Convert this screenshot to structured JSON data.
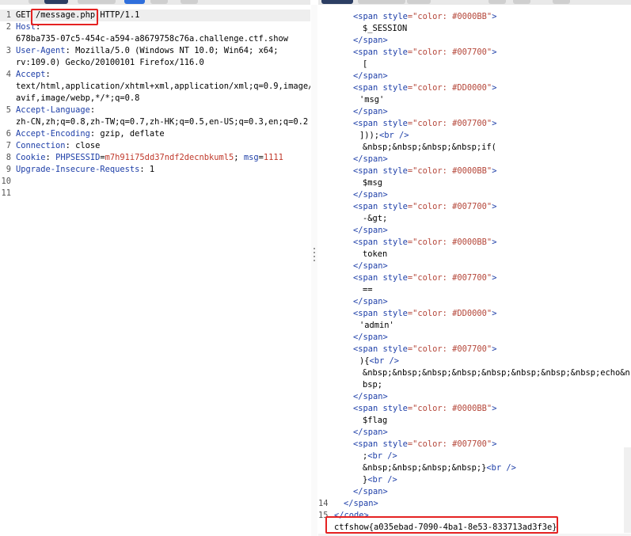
{
  "request": {
    "lines": [
      {
        "num": "1",
        "parts": [
          {
            "t": "GET ",
            "c": "hval"
          },
          {
            "t": "/message.php",
            "c": "hval"
          },
          {
            "t": " HTTP/1.1",
            "c": "hval"
          }
        ]
      },
      {
        "num": "2",
        "parts": [
          {
            "t": "Host",
            "c": "hname"
          },
          {
            "t": ":",
            "c": "hval"
          }
        ]
      },
      {
        "num": "",
        "parts": [
          {
            "t": "678ba735-07c5-454c-a594-a8679758c76a.challenge.ctf.show",
            "c": "hval"
          }
        ]
      },
      {
        "num": "3",
        "parts": [
          {
            "t": "User-Agent",
            "c": "hname"
          },
          {
            "t": ": Mozilla/5.0 (Windows NT 10.0; Win64; x64;",
            "c": "hval"
          }
        ]
      },
      {
        "num": "",
        "parts": [
          {
            "t": "rv:109.0) Gecko/20100101 Firefox/116.0",
            "c": "hval"
          }
        ]
      },
      {
        "num": "4",
        "parts": [
          {
            "t": "Accept",
            "c": "hname"
          },
          {
            "t": ":",
            "c": "hval"
          }
        ]
      },
      {
        "num": "",
        "parts": [
          {
            "t": "text/html,application/xhtml+xml,application/xml;q=0.9,image/",
            "c": "hval"
          }
        ]
      },
      {
        "num": "",
        "parts": [
          {
            "t": "avif,image/webp,*/*;q=0.8",
            "c": "hval"
          }
        ]
      },
      {
        "num": "5",
        "parts": [
          {
            "t": "Accept-Language",
            "c": "hname"
          },
          {
            "t": ":",
            "c": "hval"
          }
        ]
      },
      {
        "num": "",
        "parts": [
          {
            "t": "zh-CN,zh;q=0.8,zh-TW;q=0.7,zh-HK;q=0.5,en-US;q=0.3,en;q=0.2",
            "c": "hval"
          }
        ]
      },
      {
        "num": "6",
        "parts": [
          {
            "t": "Accept-Encoding",
            "c": "hname"
          },
          {
            "t": ": gzip, deflate",
            "c": "hval"
          }
        ]
      },
      {
        "num": "7",
        "parts": [
          {
            "t": "Connection",
            "c": "hname"
          },
          {
            "t": ": close",
            "c": "hval"
          }
        ]
      },
      {
        "num": "8",
        "parts": [
          {
            "t": "Cookie",
            "c": "hname"
          },
          {
            "t": ": ",
            "c": "hval"
          },
          {
            "t": "PHPSESSID",
            "c": "hname"
          },
          {
            "t": "=",
            "c": "hval"
          },
          {
            "t": "m7h91i75dd37ndf2decnbkuml5",
            "c": "cookie-val"
          },
          {
            "t": "; ",
            "c": "hval"
          },
          {
            "t": "msg",
            "c": "hname"
          },
          {
            "t": "=",
            "c": "hval"
          },
          {
            "t": "1111",
            "c": "cookie-val"
          }
        ]
      },
      {
        "num": "9",
        "parts": [
          {
            "t": "Upgrade-Insecure-Requests",
            "c": "hname"
          },
          {
            "t": ": 1",
            "c": "hval"
          }
        ]
      },
      {
        "num": "10",
        "parts": []
      },
      {
        "num": "11",
        "parts": []
      }
    ]
  },
  "response": {
    "lines": [
      {
        "num": "",
        "indent": 44,
        "parts": [
          {
            "t": "<span ",
            "c": "tag"
          },
          {
            "t": "style",
            "c": "attr"
          },
          {
            "t": "=\"color: #0000BB\"",
            "c": "str"
          },
          {
            "t": ">",
            "c": "tag"
          }
        ]
      },
      {
        "num": "",
        "indent": 56,
        "parts": [
          {
            "t": "$_SESSION",
            "c": "txt"
          }
        ]
      },
      {
        "num": "",
        "indent": 44,
        "parts": [
          {
            "t": "</span>",
            "c": "tag"
          }
        ]
      },
      {
        "num": "",
        "indent": 44,
        "parts": [
          {
            "t": "<span ",
            "c": "tag"
          },
          {
            "t": "style",
            "c": "attr"
          },
          {
            "t": "=\"color: #007700\"",
            "c": "str"
          },
          {
            "t": ">",
            "c": "tag"
          }
        ]
      },
      {
        "num": "",
        "indent": 56,
        "parts": [
          {
            "t": "[",
            "c": "txt"
          }
        ]
      },
      {
        "num": "",
        "indent": 44,
        "parts": [
          {
            "t": "</span>",
            "c": "tag"
          }
        ]
      },
      {
        "num": "",
        "indent": 44,
        "parts": [
          {
            "t": "<span ",
            "c": "tag"
          },
          {
            "t": "style",
            "c": "attr"
          },
          {
            "t": "=\"color: #DD0000\"",
            "c": "str"
          },
          {
            "t": ">",
            "c": "tag"
          }
        ]
      },
      {
        "num": "",
        "indent": 52,
        "parts": [
          {
            "t": "'msg'",
            "c": "txt"
          }
        ]
      },
      {
        "num": "",
        "indent": 44,
        "parts": [
          {
            "t": "</span>",
            "c": "tag"
          }
        ]
      },
      {
        "num": "",
        "indent": 44,
        "parts": [
          {
            "t": "<span ",
            "c": "tag"
          },
          {
            "t": "style",
            "c": "attr"
          },
          {
            "t": "=\"color: #007700\"",
            "c": "str"
          },
          {
            "t": ">",
            "c": "tag"
          }
        ]
      },
      {
        "num": "",
        "indent": 52,
        "parts": [
          {
            "t": "]));",
            "c": "txt"
          },
          {
            "t": "<br />",
            "c": "tag"
          }
        ]
      },
      {
        "num": "",
        "indent": 56,
        "parts": [
          {
            "t": "&nbsp;&nbsp;&nbsp;&nbsp;if(",
            "c": "txt"
          }
        ]
      },
      {
        "num": "",
        "indent": 44,
        "parts": [
          {
            "t": "</span>",
            "c": "tag"
          }
        ]
      },
      {
        "num": "",
        "indent": 44,
        "parts": [
          {
            "t": "<span ",
            "c": "tag"
          },
          {
            "t": "style",
            "c": "attr"
          },
          {
            "t": "=\"color: #0000BB\"",
            "c": "str"
          },
          {
            "t": ">",
            "c": "tag"
          }
        ]
      },
      {
        "num": "",
        "indent": 56,
        "parts": [
          {
            "t": "$msg",
            "c": "txt"
          }
        ]
      },
      {
        "num": "",
        "indent": 44,
        "parts": [
          {
            "t": "</span>",
            "c": "tag"
          }
        ]
      },
      {
        "num": "",
        "indent": 44,
        "parts": [
          {
            "t": "<span ",
            "c": "tag"
          },
          {
            "t": "style",
            "c": "attr"
          },
          {
            "t": "=\"color: #007700\"",
            "c": "str"
          },
          {
            "t": ">",
            "c": "tag"
          }
        ]
      },
      {
        "num": "",
        "indent": 56,
        "parts": [
          {
            "t": "-&gt;",
            "c": "txt"
          }
        ]
      },
      {
        "num": "",
        "indent": 44,
        "parts": [
          {
            "t": "</span>",
            "c": "tag"
          }
        ]
      },
      {
        "num": "",
        "indent": 44,
        "parts": [
          {
            "t": "<span ",
            "c": "tag"
          },
          {
            "t": "style",
            "c": "attr"
          },
          {
            "t": "=\"color: #0000BB\"",
            "c": "str"
          },
          {
            "t": ">",
            "c": "tag"
          }
        ]
      },
      {
        "num": "",
        "indent": 56,
        "parts": [
          {
            "t": "token",
            "c": "txt"
          }
        ]
      },
      {
        "num": "",
        "indent": 44,
        "parts": [
          {
            "t": "</span>",
            "c": "tag"
          }
        ]
      },
      {
        "num": "",
        "indent": 44,
        "parts": [
          {
            "t": "<span ",
            "c": "tag"
          },
          {
            "t": "style",
            "c": "attr"
          },
          {
            "t": "=\"color: #007700\"",
            "c": "str"
          },
          {
            "t": ">",
            "c": "tag"
          }
        ]
      },
      {
        "num": "",
        "indent": 56,
        "parts": [
          {
            "t": "==",
            "c": "txt"
          }
        ]
      },
      {
        "num": "",
        "indent": 44,
        "parts": [
          {
            "t": "</span>",
            "c": "tag"
          }
        ]
      },
      {
        "num": "",
        "indent": 44,
        "parts": [
          {
            "t": "<span ",
            "c": "tag"
          },
          {
            "t": "style",
            "c": "attr"
          },
          {
            "t": "=\"color: #DD0000\"",
            "c": "str"
          },
          {
            "t": ">",
            "c": "tag"
          }
        ]
      },
      {
        "num": "",
        "indent": 52,
        "parts": [
          {
            "t": "'admin'",
            "c": "txt"
          }
        ]
      },
      {
        "num": "",
        "indent": 44,
        "parts": [
          {
            "t": "</span>",
            "c": "tag"
          }
        ]
      },
      {
        "num": "",
        "indent": 44,
        "parts": [
          {
            "t": "<span ",
            "c": "tag"
          },
          {
            "t": "style",
            "c": "attr"
          },
          {
            "t": "=\"color: #007700\"",
            "c": "str"
          },
          {
            "t": ">",
            "c": "tag"
          }
        ]
      },
      {
        "num": "",
        "indent": 52,
        "parts": [
          {
            "t": "){",
            "c": "txt"
          },
          {
            "t": "<br />",
            "c": "tag"
          }
        ]
      },
      {
        "num": "",
        "indent": 56,
        "parts": [
          {
            "t": "&nbsp;&nbsp;&nbsp;&nbsp;&nbsp;&nbsp;&nbsp;&nbsp;echo&n",
            "c": "txt"
          }
        ]
      },
      {
        "num": "",
        "indent": 56,
        "parts": [
          {
            "t": "bsp;",
            "c": "txt"
          }
        ]
      },
      {
        "num": "",
        "indent": 44,
        "parts": [
          {
            "t": "</span>",
            "c": "tag"
          }
        ]
      },
      {
        "num": "",
        "indent": 44,
        "parts": [
          {
            "t": "<span ",
            "c": "tag"
          },
          {
            "t": "style",
            "c": "attr"
          },
          {
            "t": "=\"color: #0000BB\"",
            "c": "str"
          },
          {
            "t": ">",
            "c": "tag"
          }
        ]
      },
      {
        "num": "",
        "indent": 56,
        "parts": [
          {
            "t": "$flag",
            "c": "txt"
          }
        ]
      },
      {
        "num": "",
        "indent": 44,
        "parts": [
          {
            "t": "</span>",
            "c": "tag"
          }
        ]
      },
      {
        "num": "",
        "indent": 44,
        "parts": [
          {
            "t": "<span ",
            "c": "tag"
          },
          {
            "t": "style",
            "c": "attr"
          },
          {
            "t": "=\"color: #007700\"",
            "c": "str"
          },
          {
            "t": ">",
            "c": "tag"
          }
        ]
      },
      {
        "num": "",
        "indent": 56,
        "parts": [
          {
            "t": ";",
            "c": "txt"
          },
          {
            "t": "<br />",
            "c": "tag"
          }
        ]
      },
      {
        "num": "",
        "indent": 56,
        "parts": [
          {
            "t": "&nbsp;&nbsp;&nbsp;&nbsp;}",
            "c": "txt"
          },
          {
            "t": "<br />",
            "c": "tag"
          }
        ]
      },
      {
        "num": "",
        "indent": 56,
        "parts": [
          {
            "t": "}",
            "c": "txt"
          },
          {
            "t": "<br />",
            "c": "tag"
          }
        ]
      },
      {
        "num": "",
        "indent": 44,
        "parts": [
          {
            "t": "</span>",
            "c": "tag"
          }
        ]
      },
      {
        "num": "14",
        "indent": 32,
        "parts": [
          {
            "t": "</span>",
            "c": "tag"
          }
        ]
      },
      {
        "num": "15",
        "indent": 20,
        "parts": [
          {
            "t": "</code>",
            "c": "tag"
          }
        ]
      },
      {
        "num": "",
        "indent": 20,
        "parts": [
          {
            "t": "ctfshow{a035ebad-7090-4ba1-8e53-833713ad3f3e}",
            "c": "txt"
          }
        ]
      }
    ]
  }
}
